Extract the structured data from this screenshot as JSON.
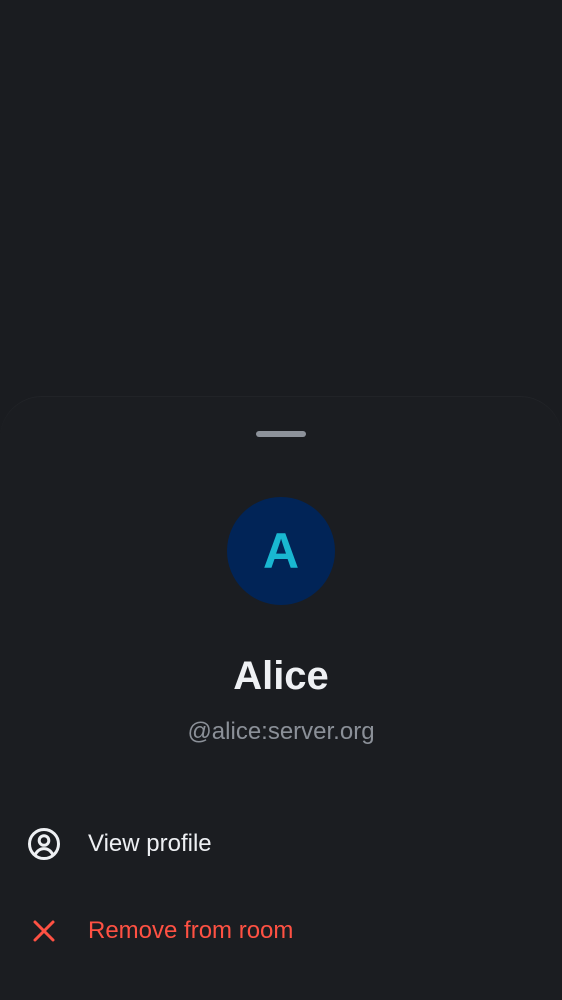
{
  "sheet": {
    "avatar": {
      "initial": "A",
      "background_color": "#012457",
      "initial_color": "#19b7d1"
    },
    "display_name": "Alice",
    "user_id": "@alice:server.org",
    "actions": [
      {
        "label": "View profile",
        "icon": "user-profile-icon"
      },
      {
        "label": "Remove from room",
        "icon": "close-icon",
        "color": "#ff5143"
      }
    ]
  }
}
